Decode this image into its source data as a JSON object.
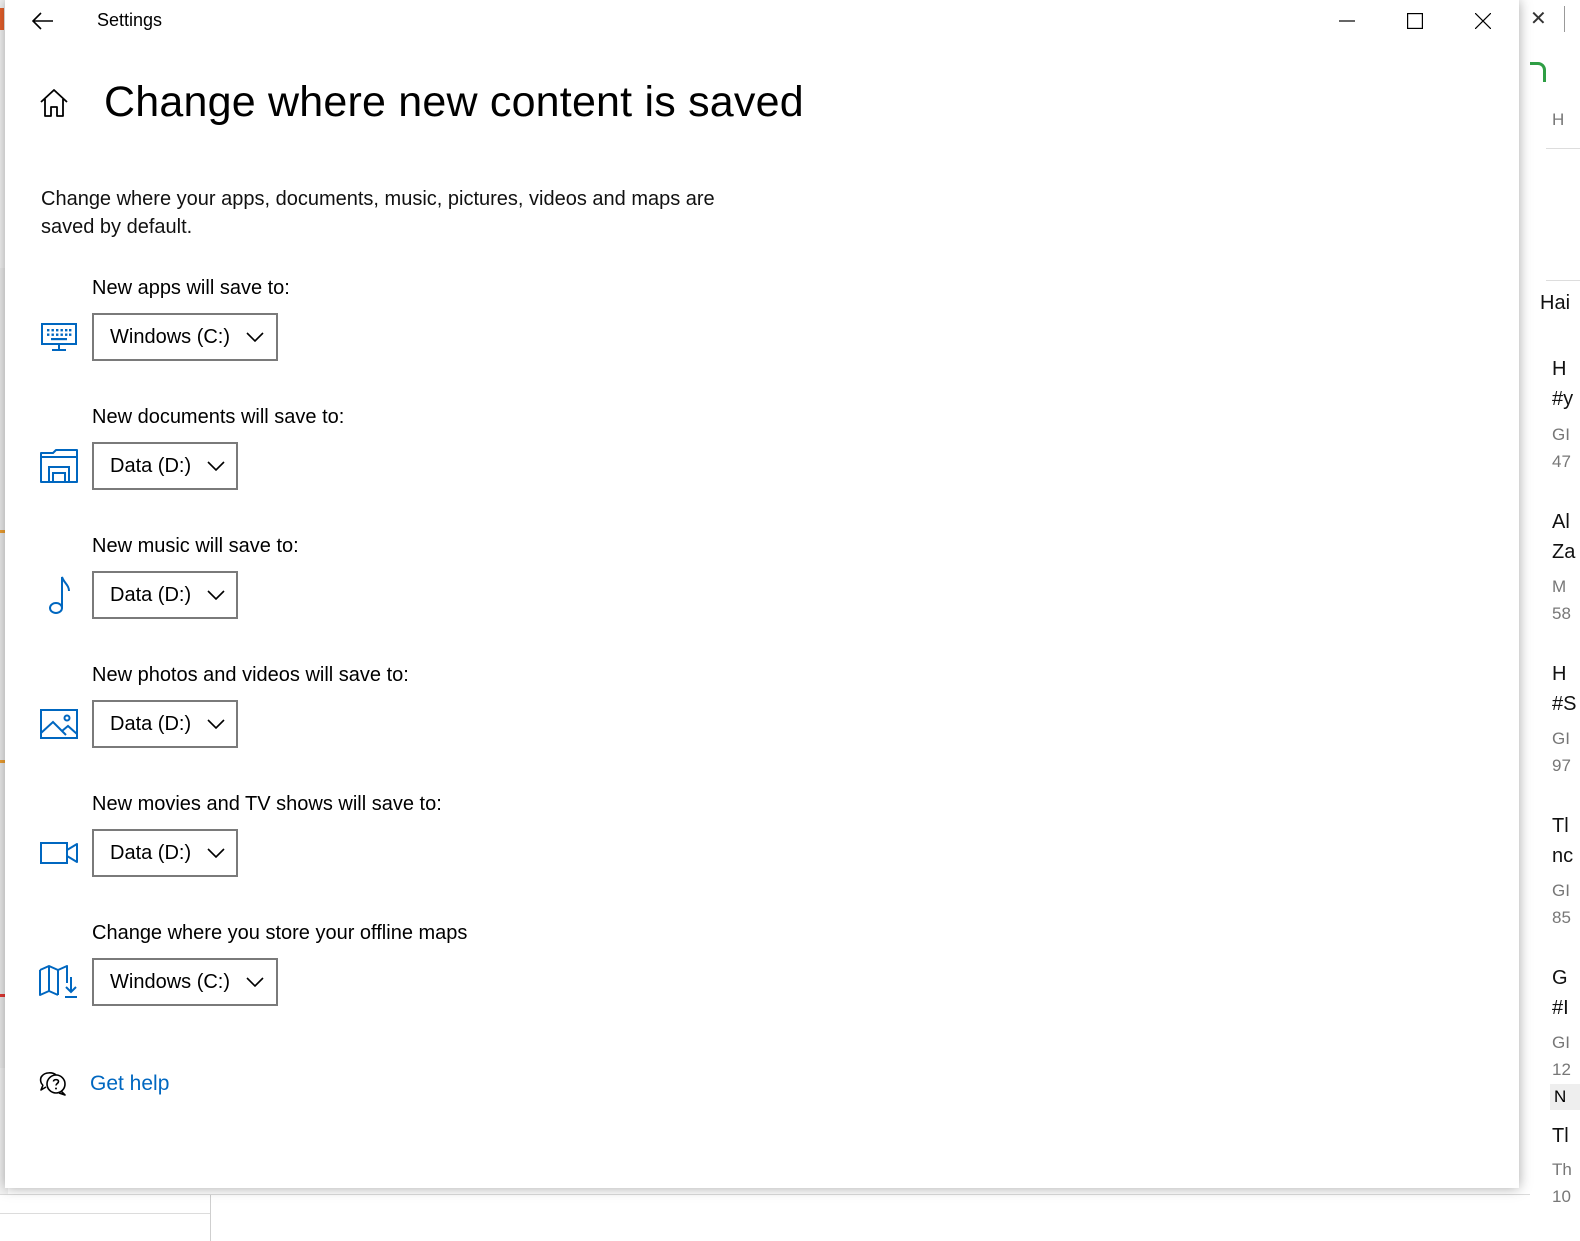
{
  "window": {
    "title": "Settings"
  },
  "page": {
    "title": "Change where new content is saved",
    "description": "Change where your apps, documents, music, pictures, videos and maps are saved by default."
  },
  "sections": [
    {
      "label": "New apps will save to:",
      "value": "Windows (C:)",
      "icon": "monitor-keyboard-icon"
    },
    {
      "label": "New documents will save to:",
      "value": "Data (D:)",
      "icon": "folder-icon"
    },
    {
      "label": "New music will save to:",
      "value": "Data (D:)",
      "icon": "music-note-icon"
    },
    {
      "label": "New photos and videos will save to:",
      "value": "Data (D:)",
      "icon": "picture-icon"
    },
    {
      "label": "New movies and TV shows will save to:",
      "value": "Data (D:)",
      "icon": "video-camera-icon"
    },
    {
      "label": "Change where you store your offline maps",
      "value": "Windows (C:)",
      "icon": "map-download-icon"
    }
  ],
  "help": {
    "label": "Get help"
  },
  "colors": {
    "accent": "#0067c0",
    "icon": "#0067c0",
    "dropdown_border": "#7a7a7a"
  },
  "background_app": {
    "partial_texts": [
      "H",
      "Hai",
      "H",
      "#y",
      "GI",
      "47",
      "Al",
      "Za",
      "M",
      "58",
      "H",
      "#S",
      "GI",
      "97",
      "Tl",
      "nc",
      "GI",
      "85",
      "G",
      "#I",
      "GI",
      "12",
      "N",
      "Tl",
      "Th",
      "10"
    ]
  }
}
